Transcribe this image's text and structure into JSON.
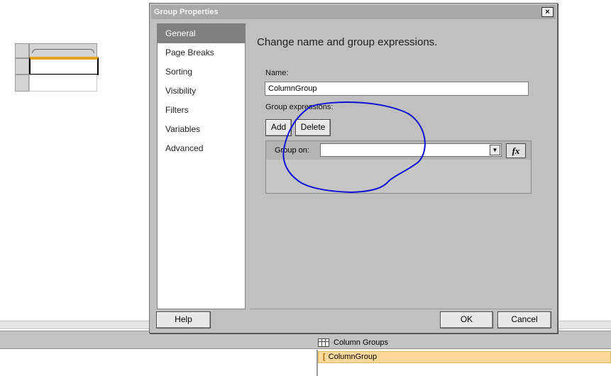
{
  "dialog": {
    "title": "Group Properties",
    "close_glyph": "×",
    "nav": [
      {
        "label": "General",
        "active": true
      },
      {
        "label": "Page Breaks"
      },
      {
        "label": "Sorting"
      },
      {
        "label": "Visibility"
      },
      {
        "label": "Filters"
      },
      {
        "label": "Variables"
      },
      {
        "label": "Advanced"
      }
    ],
    "heading": "Change name and group expressions.",
    "name_label": "Name:",
    "name_value": "ColumnGroup",
    "group_expressions_label": "Group expressions:",
    "add_label": "Add",
    "delete_label": "Delete",
    "group_on_label": "Group on:",
    "group_on_value": "",
    "combo_arrow": "▼",
    "fx_label": "fx",
    "help_label": "Help",
    "ok_label": "OK",
    "cancel_label": "Cancel"
  },
  "grouping_pane": {
    "column_groups_title": "Column Groups",
    "column_group_item": "ColumnGroup",
    "item_bracket": "["
  },
  "colors": {
    "selection_highlight": "#fbd99a",
    "annotation_ink": "#1010d8"
  }
}
